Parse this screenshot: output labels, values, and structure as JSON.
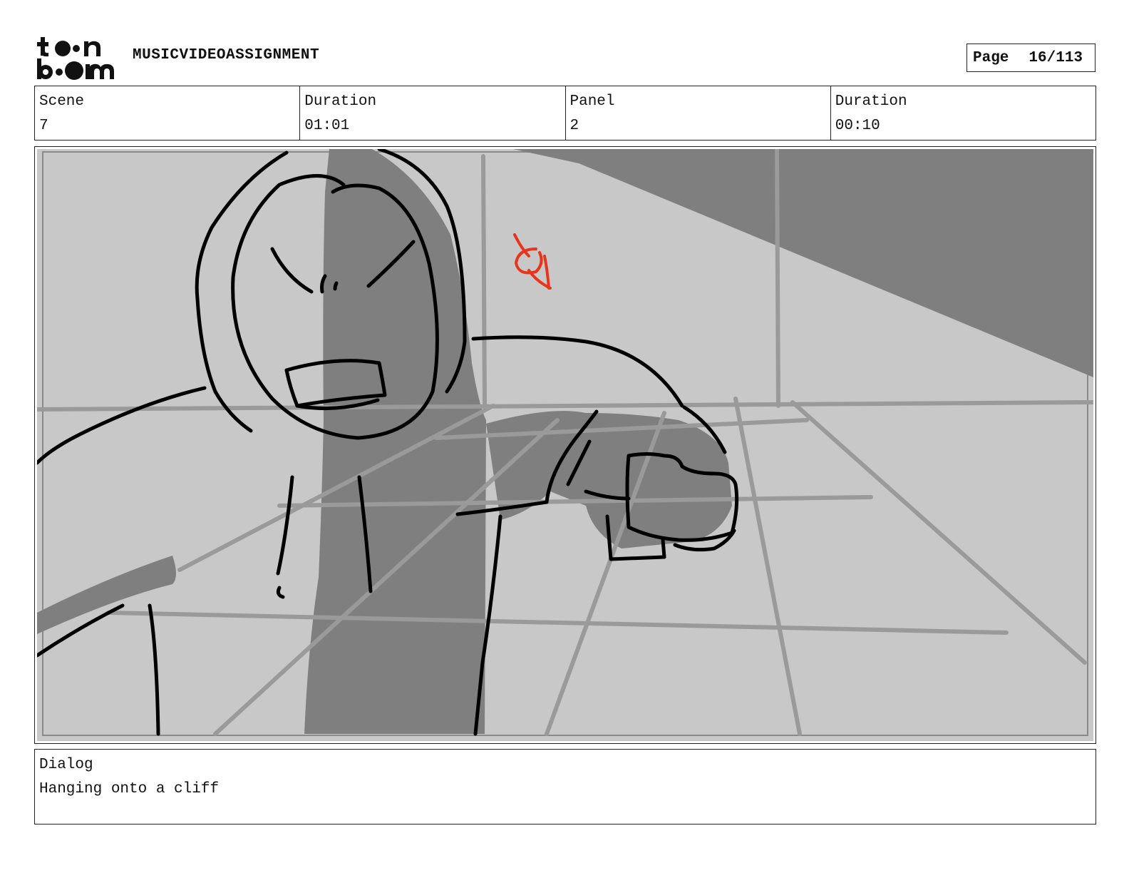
{
  "header": {
    "logo_text": "toon boom",
    "project_title": "MUSICVIDEOASSIGNMENT",
    "page_label": "Page",
    "page_number": "16/113"
  },
  "info": {
    "scene_label": "Scene",
    "scene_value": "7",
    "scene_duration_label": "Duration",
    "scene_duration_value": "01:01",
    "panel_label": "Panel",
    "panel_value": "2",
    "panel_duration_label": "Duration",
    "panel_duration_value": "00:10"
  },
  "dialog": {
    "label": "Dialog",
    "text": "Hanging onto a cliff"
  },
  "colors": {
    "sketch_light": "#c8c8c8",
    "sketch_shadow": "#7f7f7f",
    "sketch_line": "#000000",
    "annotation": "#e8341c"
  }
}
